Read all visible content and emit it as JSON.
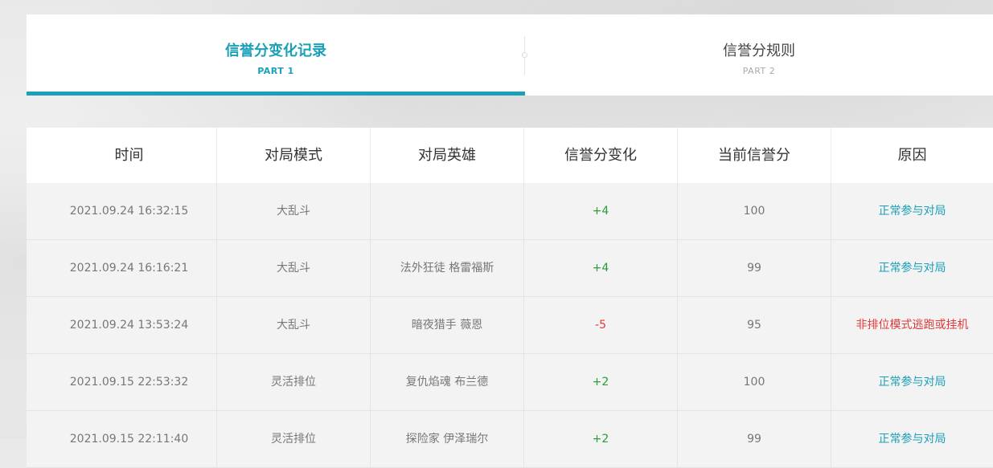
{
  "tabs": [
    {
      "title": "信誉分变化记录",
      "sub": "PART 1",
      "active": true
    },
    {
      "title": "信誉分规则",
      "sub": "PART 2",
      "active": false
    }
  ],
  "table": {
    "headers": [
      "时间",
      "对局模式",
      "对局英雄",
      "信誉分变化",
      "当前信誉分",
      "原因"
    ],
    "rows": [
      {
        "time": "2021.09.24 16:32:15",
        "mode": "大乱斗",
        "hero": "",
        "change": "+4",
        "score": "100",
        "reason": "正常参与对局"
      },
      {
        "time": "2021.09.24 16:16:21",
        "mode": "大乱斗",
        "hero": "法外狂徒 格雷福斯",
        "change": "+4",
        "score": "99",
        "reason": "正常参与对局"
      },
      {
        "time": "2021.09.24 13:53:24",
        "mode": "大乱斗",
        "hero": "暗夜猎手 薇恩",
        "change": "-5",
        "score": "95",
        "reason": "非排位模式逃跑或挂机"
      },
      {
        "time": "2021.09.15 22:53:32",
        "mode": "灵活排位",
        "hero": "复仇焰魂 布兰德",
        "change": "+2",
        "score": "100",
        "reason": "正常参与对局"
      },
      {
        "time": "2021.09.15 22:11:40",
        "mode": "灵活排位",
        "hero": "探险家 伊泽瑞尔",
        "change": "+2",
        "score": "99",
        "reason": "正常参与对局"
      }
    ]
  },
  "colors": {
    "accent": "#1aa0b8",
    "positive": "#2a9c3a",
    "negative": "#e03a3a"
  }
}
